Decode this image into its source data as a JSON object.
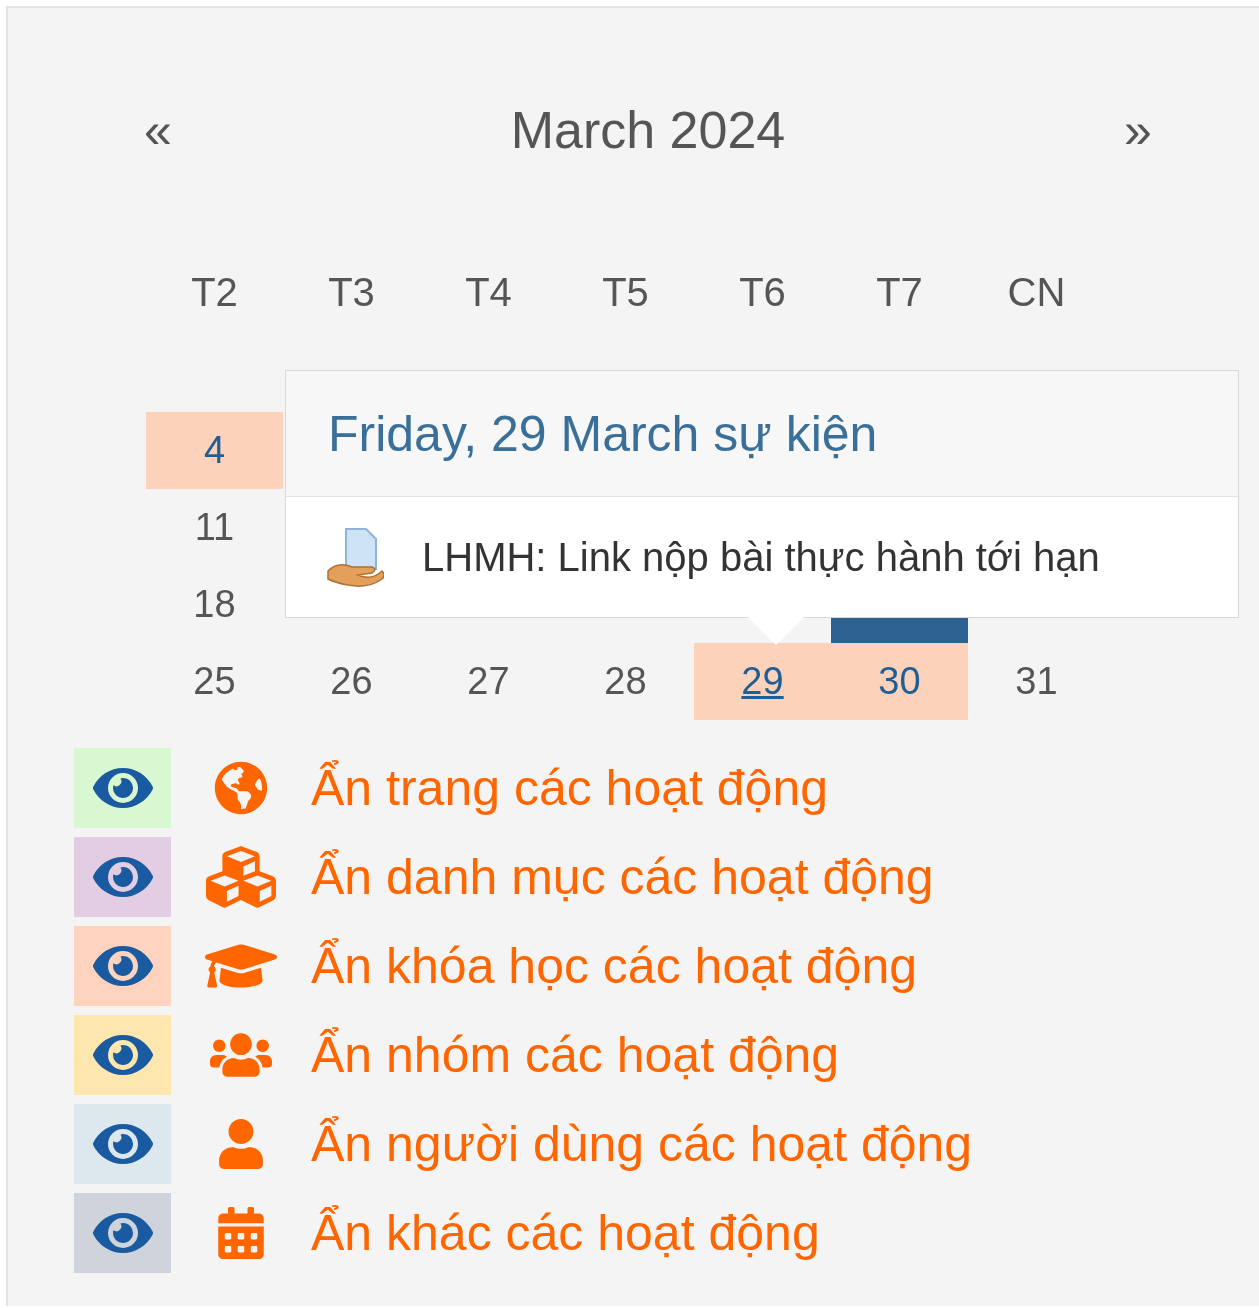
{
  "calendar": {
    "prev": "«",
    "title": "March 2024",
    "next": "»",
    "weekdays": [
      "T2",
      "T3",
      "T4",
      "T5",
      "T6",
      "T7",
      "CN"
    ],
    "weeks": [
      [
        {
          "day": "4",
          "event": true,
          "today": false
        }
      ],
      [
        {
          "day": "11",
          "event": false,
          "today": false
        }
      ],
      [
        {
          "day": "18",
          "event": false,
          "today": false
        },
        {
          "event": false,
          "today": false
        },
        {
          "event": false,
          "today": false
        },
        {
          "event": false,
          "today": false
        },
        {
          "event": false,
          "today": false
        },
        {
          "event": false,
          "today": true
        },
        {
          "event": false,
          "today": false
        }
      ],
      [
        {
          "day": "25",
          "event": false,
          "today": false
        },
        {
          "day": "26",
          "event": false,
          "today": false
        },
        {
          "day": "27",
          "event": false,
          "today": false
        },
        {
          "day": "28",
          "event": false,
          "today": false
        },
        {
          "day": "29",
          "event": true,
          "today": false,
          "hovered": true
        },
        {
          "day": "30",
          "event": true,
          "today": false
        },
        {
          "day": "31",
          "event": false,
          "today": false
        }
      ]
    ],
    "popover": {
      "title": "Friday, 29 March sự kiện",
      "events": [
        {
          "name": "LHMH: Link nộp bài thực hành tới hạn"
        }
      ]
    }
  },
  "legend": [
    {
      "kind": "site",
      "color": "#d7f8d0",
      "label": "Ẩn trang các hoạt động"
    },
    {
      "kind": "category",
      "color": "#e2cde2",
      "label": "Ẩn danh mục các hoạt động"
    },
    {
      "kind": "course",
      "color": "#ffd3bd",
      "label": "Ẩn khóa học các hoạt động"
    },
    {
      "kind": "group",
      "color": "#fee7ae",
      "label": "Ẩn nhóm các hoạt động"
    },
    {
      "kind": "user",
      "color": "#dce7ee",
      "label": "Ẩn người dùng các hoạt động"
    },
    {
      "kind": "other",
      "color": "#ced3dc",
      "label": "Ẩn khác các hoạt động"
    }
  ]
}
